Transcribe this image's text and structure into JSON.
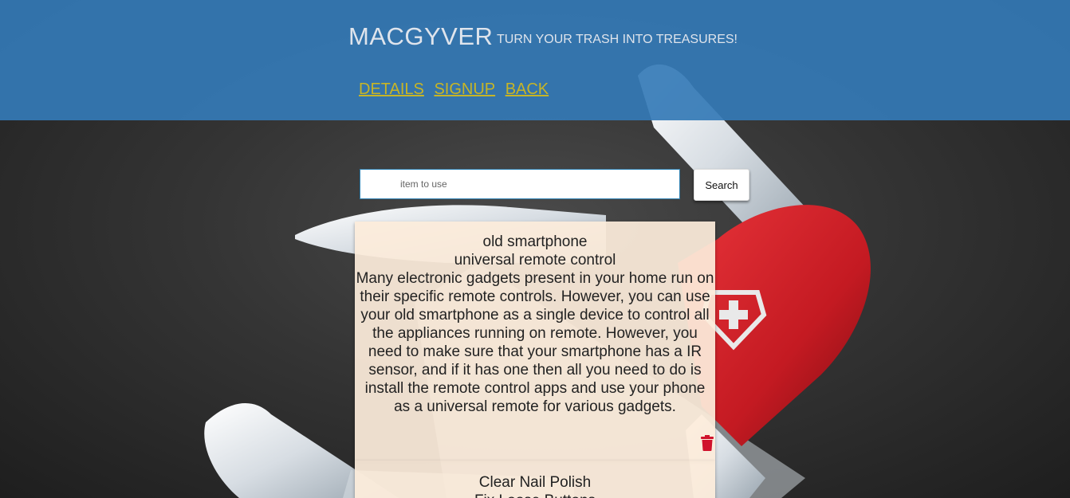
{
  "header": {
    "brand": "MACGYVER",
    "tagline": "TURN YOUR TRASH INTO TREASURES!"
  },
  "nav": {
    "items": [
      {
        "label": "DETAILS"
      },
      {
        "label": "SIGNUP"
      },
      {
        "label": "BACK"
      }
    ]
  },
  "search": {
    "placeholder": "item to use",
    "value": "",
    "button_label": "Search"
  },
  "results": [
    {
      "item": "old smartphone",
      "use": "universal remote control",
      "description": "Many electronic gadgets present in your home run on their specific remote controls. However, you can use your old smartphone as a single device to control all the appliances running on remote. However, you need to make sure that your smartphone has a IR sensor, and if it has one then all you need to do is install the remote control apps and use your phone as a universal remote for various gadgets.",
      "delete_icon": "trash-icon"
    },
    {
      "item": "Clear Nail Polish",
      "use": "Fix Loose Buttons"
    }
  ],
  "colors": {
    "header_bg": "#347ab6",
    "nav_link": "#c7b526",
    "card_bg": "#fcecda",
    "delete_icon": "#d0122c",
    "knife_red": "#c41a22"
  }
}
